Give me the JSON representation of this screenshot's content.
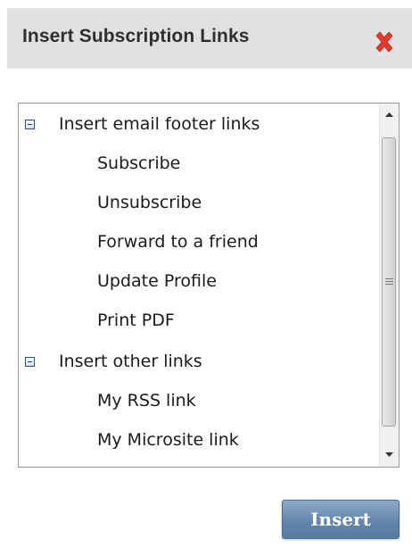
{
  "dialog": {
    "title": "Insert Subscription Links",
    "close_icon": "close-x-icon",
    "close_color": "#e03b2f"
  },
  "tree": {
    "groups": [
      {
        "label": "Insert email footer links",
        "expanded": true,
        "items": [
          "Subscribe",
          "Unsubscribe",
          "Forward to a friend",
          "Update Profile",
          "Print PDF"
        ]
      },
      {
        "label": "Insert other links",
        "expanded": true,
        "items": [
          "My RSS link",
          "My Microsite link"
        ]
      }
    ]
  },
  "actions": {
    "insert_label": "Insert",
    "insert_color": "#6485ab"
  }
}
